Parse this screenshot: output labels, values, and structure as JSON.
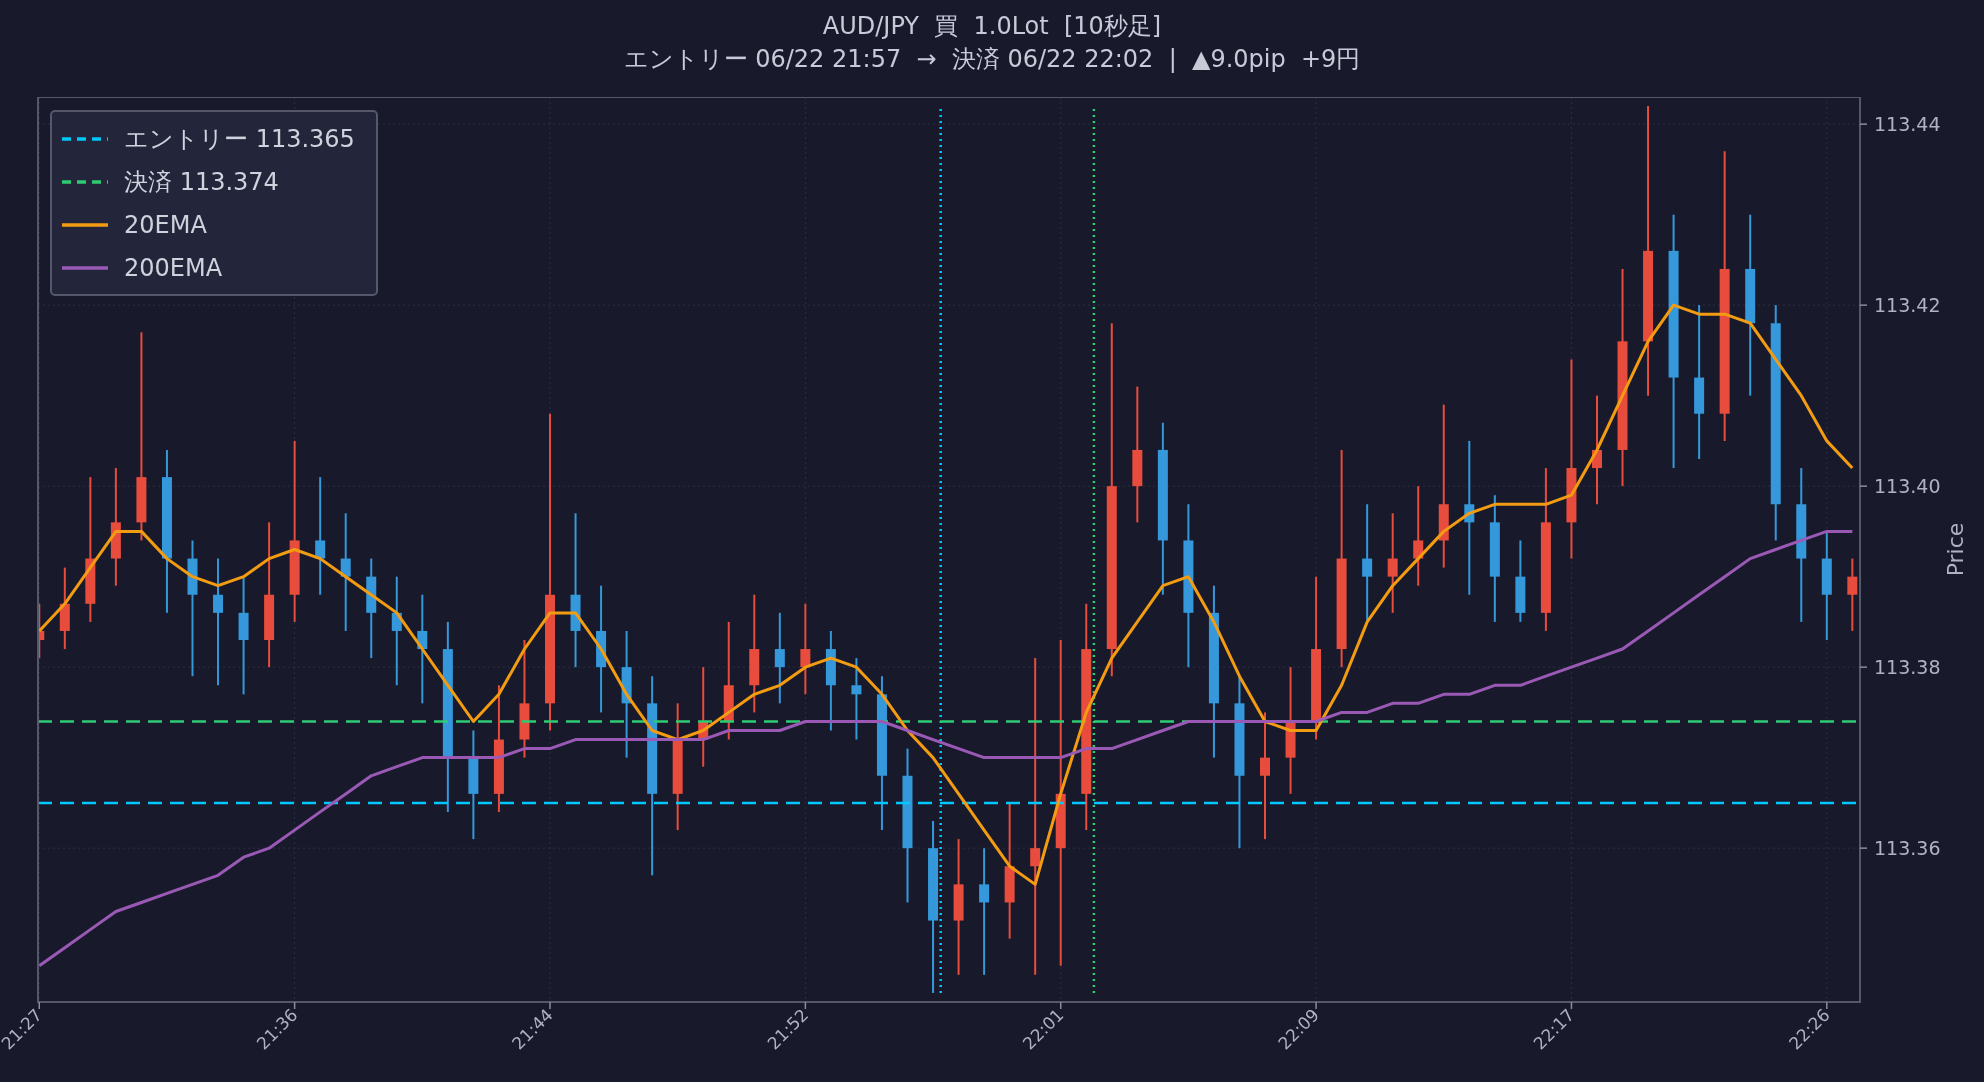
{
  "title": {
    "line_1": "AUD/JPY  買  1.0Lot  [10秒足]",
    "line_2": "エントリー 06/22 21:57  →  決済 06/22 22:02  |  ▲9.0pip  +9円"
  },
  "chart": {
    "chart_data": {
      "type": "candlestick",
      "ylabel": "Price",
      "categories": [
        "21:27",
        null,
        null,
        null,
        null,
        null,
        null,
        null,
        null,
        null,
        "21:36",
        null,
        null,
        null,
        null,
        null,
        null,
        null,
        null,
        null,
        "21:44",
        null,
        null,
        null,
        null,
        null,
        null,
        null,
        null,
        null,
        "21:52",
        null,
        null,
        null,
        null,
        null,
        null,
        null,
        null,
        null,
        "22:01",
        null,
        null,
        null,
        null,
        null,
        null,
        null,
        null,
        null,
        "22:09",
        null,
        null,
        null,
        null,
        null,
        null,
        null,
        null,
        null,
        "22:17",
        null,
        null,
        null,
        null,
        null,
        null,
        null,
        null,
        null,
        "22:26",
        null
      ],
      "grid": true,
      "ylim": [
        113.343,
        113.443
      ],
      "yticks": [
        {
          "value": 113.36,
          "label": "113.36"
        },
        {
          "value": 113.38,
          "label": "113.38"
        },
        {
          "value": 113.4,
          "label": "113.40"
        },
        {
          "value": 113.42,
          "label": "113.42"
        },
        {
          "value": 113.44,
          "label": "113.44"
        }
      ],
      "ohlc": [
        [
          113.383,
          113.387,
          113.381,
          113.384
        ],
        [
          113.384,
          113.391,
          113.382,
          113.387
        ],
        [
          113.387,
          113.401,
          113.385,
          113.392
        ],
        [
          113.392,
          113.402,
          113.389,
          113.396
        ],
        [
          113.396,
          113.417,
          113.394,
          113.401
        ],
        [
          113.401,
          113.404,
          113.386,
          113.392
        ],
        [
          113.392,
          113.394,
          113.379,
          113.388
        ],
        [
          113.388,
          113.392,
          113.378,
          113.386
        ],
        [
          113.386,
          113.39,
          113.377,
          113.383
        ],
        [
          113.383,
          113.396,
          113.38,
          113.388
        ],
        [
          113.388,
          113.405,
          113.385,
          113.394
        ],
        [
          113.394,
          113.401,
          113.388,
          113.392
        ],
        [
          113.392,
          113.397,
          113.384,
          113.39
        ],
        [
          113.39,
          113.392,
          113.381,
          113.386
        ],
        [
          113.386,
          113.39,
          113.378,
          113.384
        ],
        [
          113.384,
          113.388,
          113.376,
          113.382
        ],
        [
          113.382,
          113.385,
          113.364,
          113.37
        ],
        [
          113.37,
          113.373,
          113.361,
          113.366
        ],
        [
          113.366,
          113.378,
          113.364,
          113.372
        ],
        [
          113.372,
          113.383,
          113.37,
          113.376
        ],
        [
          113.376,
          113.408,
          113.373,
          113.388
        ],
        [
          113.388,
          113.397,
          113.38,
          113.384
        ],
        [
          113.384,
          113.389,
          113.375,
          113.38
        ],
        [
          113.38,
          113.384,
          113.37,
          113.376
        ],
        [
          113.376,
          113.379,
          113.357,
          113.366
        ],
        [
          113.366,
          113.376,
          113.362,
          113.372
        ],
        [
          113.372,
          113.38,
          113.369,
          113.374
        ],
        [
          113.374,
          113.385,
          113.372,
          113.378
        ],
        [
          113.378,
          113.388,
          113.375,
          113.382
        ],
        [
          113.382,
          113.386,
          113.376,
          113.38
        ],
        [
          113.38,
          113.387,
          113.377,
          113.382
        ],
        [
          113.382,
          113.384,
          113.373,
          113.378
        ],
        [
          113.378,
          113.381,
          113.372,
          113.377
        ],
        [
          113.377,
          113.379,
          113.362,
          113.368
        ],
        [
          113.368,
          113.371,
          113.354,
          113.36
        ],
        [
          113.36,
          113.363,
          113.344,
          113.352
        ],
        [
          113.352,
          113.361,
          113.346,
          113.356
        ],
        [
          113.356,
          113.36,
          113.346,
          113.354
        ],
        [
          113.354,
          113.365,
          113.35,
          113.358
        ],
        [
          113.358,
          113.381,
          113.346,
          113.36
        ],
        [
          113.36,
          113.383,
          113.347,
          113.366
        ],
        [
          113.366,
          113.387,
          113.362,
          113.382
        ],
        [
          113.382,
          113.418,
          113.379,
          113.4
        ],
        [
          113.4,
          113.411,
          113.396,
          113.404
        ],
        [
          113.404,
          113.407,
          113.388,
          113.394
        ],
        [
          113.394,
          113.398,
          113.38,
          113.386
        ],
        [
          113.386,
          113.389,
          113.37,
          113.376
        ],
        [
          113.376,
          113.379,
          113.36,
          113.368
        ],
        [
          113.368,
          113.375,
          113.361,
          113.37
        ],
        [
          113.37,
          113.38,
          113.366,
          113.374
        ],
        [
          113.374,
          113.39,
          113.372,
          113.382
        ],
        [
          113.382,
          113.404,
          113.38,
          113.392
        ],
        [
          113.392,
          113.398,
          113.385,
          113.39
        ],
        [
          113.39,
          113.397,
          113.386,
          113.392
        ],
        [
          113.392,
          113.4,
          113.389,
          113.394
        ],
        [
          113.394,
          113.409,
          113.391,
          113.398
        ],
        [
          113.398,
          113.405,
          113.388,
          113.396
        ],
        [
          113.396,
          113.399,
          113.385,
          113.39
        ],
        [
          113.39,
          113.394,
          113.385,
          113.386
        ],
        [
          113.386,
          113.402,
          113.384,
          113.396
        ],
        [
          113.396,
          113.414,
          113.392,
          113.402
        ],
        [
          113.402,
          113.41,
          113.398,
          113.404
        ],
        [
          113.404,
          113.424,
          113.4,
          113.416
        ],
        [
          113.416,
          113.442,
          113.41,
          113.426
        ],
        [
          113.426,
          113.43,
          113.402,
          113.412
        ],
        [
          113.412,
          113.42,
          113.403,
          113.408
        ],
        [
          113.408,
          113.437,
          113.405,
          113.424
        ],
        [
          113.424,
          113.43,
          113.41,
          113.418
        ],
        [
          113.418,
          113.42,
          113.394,
          113.398
        ],
        [
          113.398,
          113.402,
          113.385,
          113.392
        ],
        [
          113.392,
          113.395,
          113.383,
          113.388
        ],
        [
          113.388,
          113.392,
          113.384,
          113.39
        ]
      ],
      "ref_lines": [
        {
          "axis": "y",
          "value": 113.365,
          "label": "エントリー 113.365",
          "color": "#00c8ff"
        },
        {
          "axis": "y",
          "value": 113.374,
          "label": "決済 113.374",
          "color": "#2ecc71"
        }
      ],
      "series": [
        {
          "name": "20EMA",
          "type": "line",
          "color": "#f39c12",
          "values": [
            113.384,
            113.387,
            113.391,
            113.395,
            113.395,
            113.392,
            113.39,
            113.389,
            113.39,
            113.392,
            113.393,
            113.392,
            113.39,
            113.388,
            113.386,
            113.382,
            113.378,
            113.374,
            113.377,
            113.382,
            113.386,
            113.386,
            113.382,
            113.377,
            113.373,
            113.372,
            113.373,
            113.375,
            113.377,
            113.378,
            113.38,
            113.381,
            113.38,
            113.377,
            113.373,
            113.37,
            113.366,
            113.362,
            113.358,
            113.356,
            113.366,
            113.375,
            113.381,
            113.385,
            113.389,
            113.39,
            113.385,
            113.379,
            113.374,
            113.373,
            113.373,
            113.378,
            113.385,
            113.389,
            113.392,
            113.395,
            113.397,
            113.398,
            113.398,
            113.398,
            113.399,
            113.404,
            113.41,
            113.416,
            113.42,
            113.419,
            113.419,
            113.418,
            113.414,
            113.41,
            113.405,
            113.402
          ]
        },
        {
          "name": "200EMA",
          "type": "line",
          "color": "#9b59b6",
          "values": [
            113.347,
            113.349,
            113.351,
            113.353,
            113.354,
            113.355,
            113.356,
            113.357,
            113.359,
            113.36,
            113.362,
            113.364,
            113.366,
            113.368,
            113.369,
            113.37,
            113.37,
            113.37,
            113.37,
            113.371,
            113.371,
            113.372,
            113.372,
            113.372,
            113.372,
            113.372,
            113.372,
            113.373,
            113.373,
            113.373,
            113.374,
            113.374,
            113.374,
            113.374,
            113.373,
            113.372,
            113.371,
            113.37,
            113.37,
            113.37,
            113.37,
            113.371,
            113.371,
            113.372,
            113.373,
            113.374,
            113.374,
            113.374,
            113.374,
            113.374,
            113.374,
            113.375,
            113.375,
            113.376,
            113.376,
            113.377,
            113.377,
            113.378,
            113.378,
            113.379,
            113.38,
            113.381,
            113.382,
            113.384,
            113.386,
            113.388,
            113.39,
            113.392,
            113.393,
            113.394,
            113.395,
            113.395
          ]
        }
      ]
    }
  }
}
